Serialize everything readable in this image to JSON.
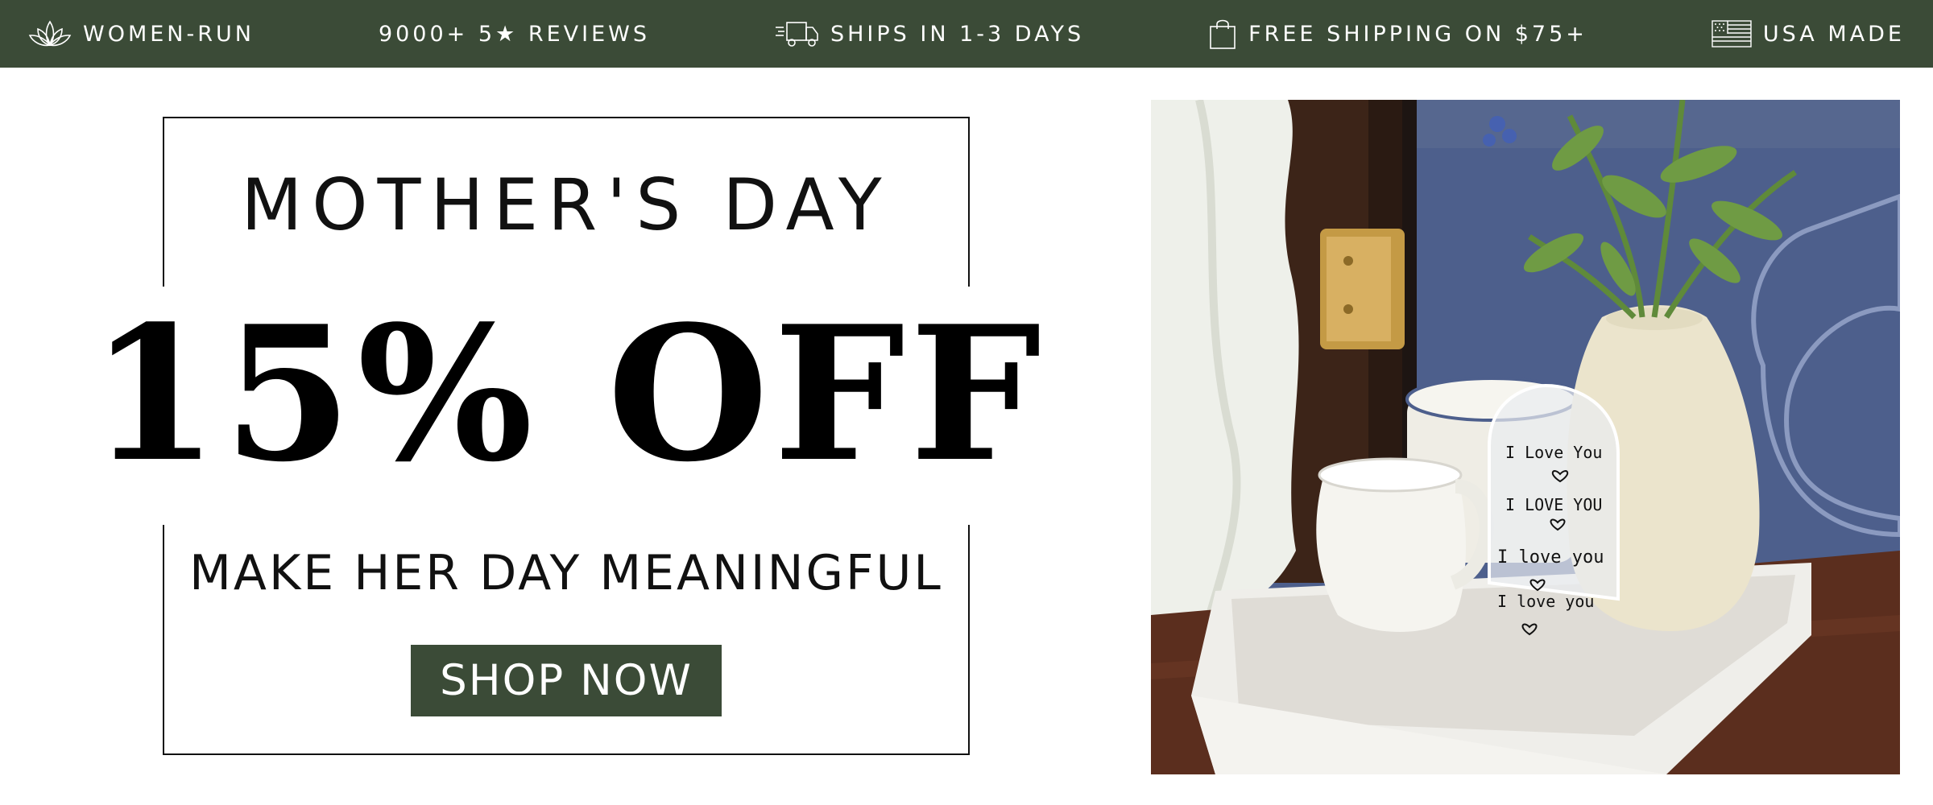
{
  "topbar": {
    "items": [
      {
        "label": "WOMEN-RUN",
        "icon": "lotus-icon"
      },
      {
        "label": "9000+ 5★ REVIEWS",
        "icon": ""
      },
      {
        "label": "SHIPS IN 1-3 DAYS",
        "icon": "delivery-truck-icon"
      },
      {
        "label": "FREE SHIPPING ON $75+",
        "icon": "shopping-bag-icon"
      },
      {
        "label": "USA MADE",
        "icon": "us-flag-icon"
      }
    ]
  },
  "promo": {
    "eyebrow": "MOTHER'S DAY",
    "headline": "15% OFF",
    "subheadline": "MAKE HER DAY MEANINGFUL",
    "cta_label": "SHOP NOW"
  },
  "photo": {
    "plaque_lines": [
      "I Love You",
      "I LOVE YOU",
      "I love you",
      "I love you"
    ]
  },
  "colors": {
    "brand_green": "#3b4b37",
    "text": "#111111",
    "background": "#ffffff"
  }
}
